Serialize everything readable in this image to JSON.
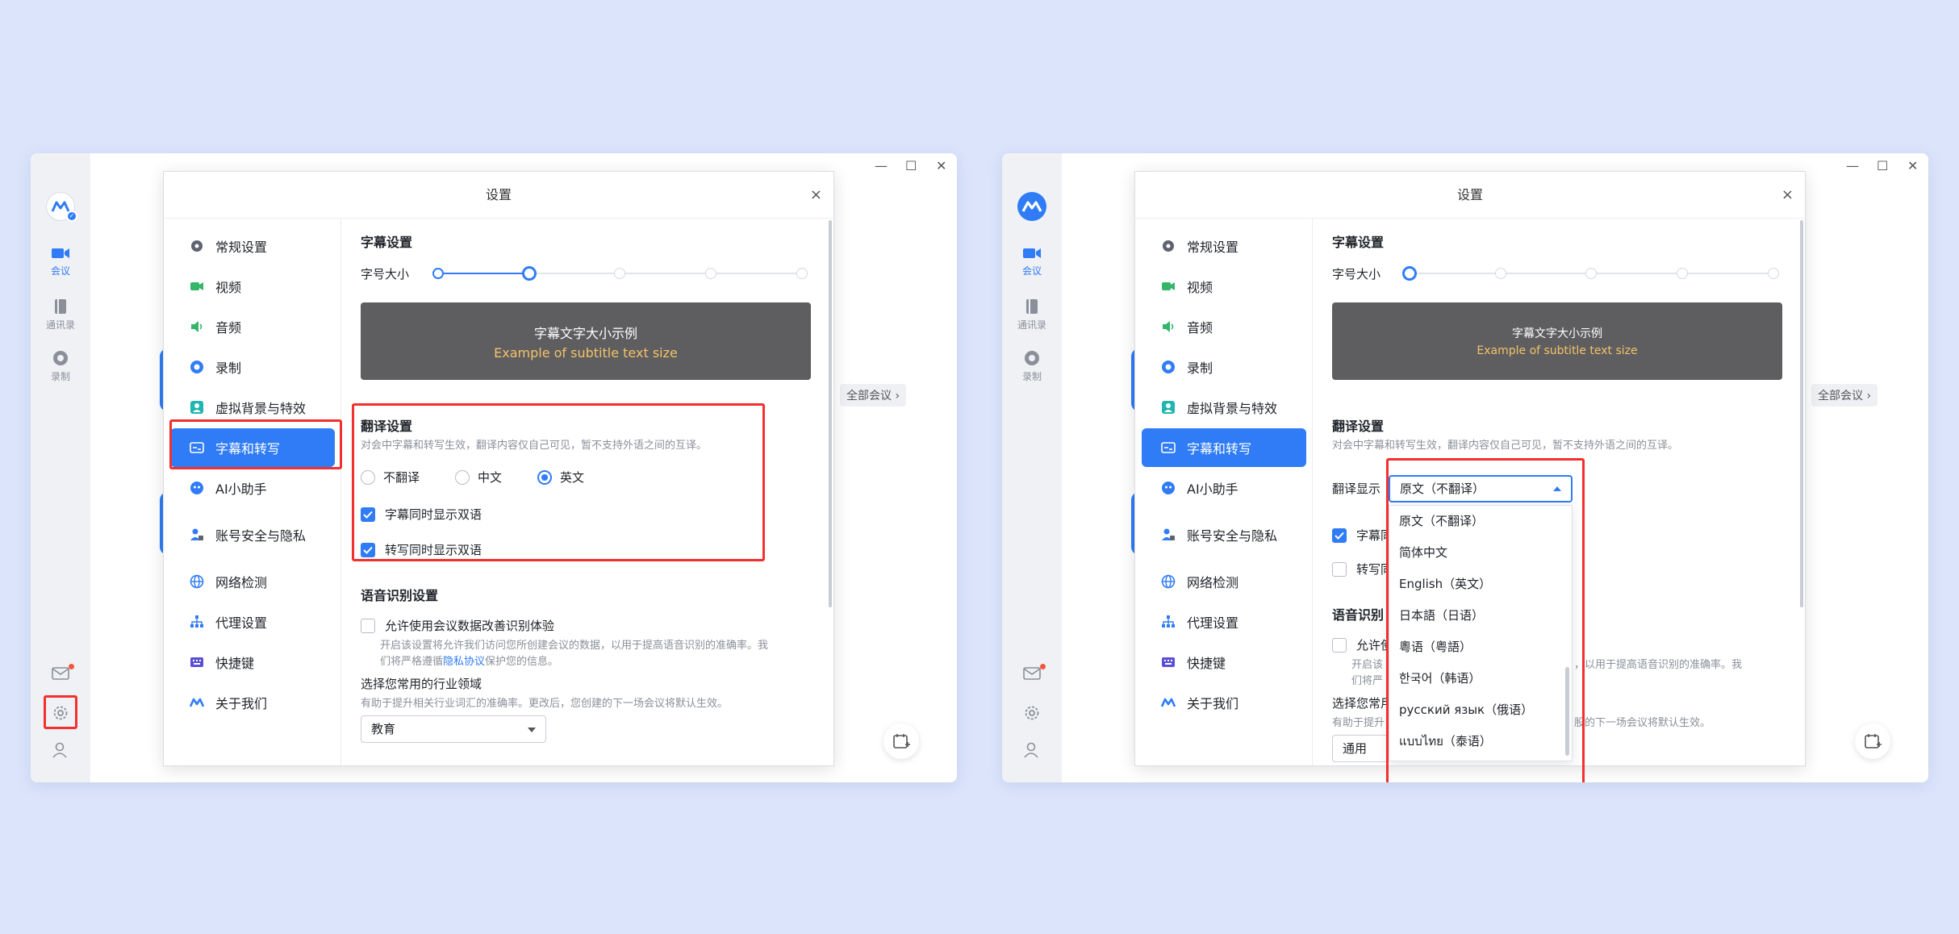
{
  "colors": {
    "accent": "#2f7cf6",
    "highlight": "#f2302f",
    "subtitle_en": "#f5c269",
    "background": "#dbe4fb"
  },
  "rail": {
    "items": [
      {
        "label": "会议",
        "icon": "video-camera-icon"
      },
      {
        "label": "通讯录",
        "icon": "address-book-icon"
      },
      {
        "label": "录制",
        "icon": "record-icon"
      }
    ],
    "bottom_icons": [
      "mail-icon",
      "gear-icon",
      "user-settings-icon"
    ]
  },
  "window": {
    "controls": [
      "—",
      "☐",
      "✕"
    ]
  },
  "all_meetings": "全部会议 ›",
  "dialog": {
    "title": "设置",
    "close": "×",
    "nav": [
      {
        "label": "常规设置",
        "icon": "gear-icon"
      },
      {
        "label": "视频",
        "icon": "video-icon"
      },
      {
        "label": "音频",
        "icon": "speaker-icon"
      },
      {
        "label": "录制",
        "icon": "record-icon"
      },
      {
        "label": "虚拟背景与特效",
        "icon": "portrait-icon"
      },
      {
        "label": "字幕和转写",
        "icon": "caption-icon"
      },
      {
        "label": "AI小助手",
        "icon": "ai-assistant-icon"
      },
      {
        "label": "账号安全与隐私",
        "icon": "account-security-icon"
      },
      {
        "label": "网络检测",
        "icon": "globe-icon"
      },
      {
        "label": "代理设置",
        "icon": "proxy-icon"
      },
      {
        "label": "快捷键",
        "icon": "keyboard-icon"
      },
      {
        "label": "关于我们",
        "icon": "logo-icon"
      }
    ]
  },
  "subtitle": {
    "section_title": "字幕设置",
    "size_label": "字号大小",
    "preview_cn": "字幕文字大小示例",
    "preview_en": "Example of subtitle text size"
  },
  "translation": {
    "section_title": "翻译设置",
    "note_left": "对会中字幕和转写生效，翻译内容仅自己可见，暂不支持外语之间的互译。",
    "note_right": "对会中字幕和转写生效，翻译内容仅自己可见，暂不支持外语之间的互译。",
    "options": [
      "不翻译",
      "中文",
      "英文"
    ],
    "selected_option": "英文",
    "bilingual_subtitle": "字幕同时显示双语",
    "bilingual_transcript": "转写同时显示双语",
    "display_label": "翻译显示",
    "display_value": "原文（不翻译）",
    "bilingual_subtitle_partial": "字幕同",
    "bilingual_transcript_partial": "转写同",
    "dropdown_options": [
      "原文（不翻译）",
      "简体中文",
      "English（英文）",
      "日本語（日语）",
      "粵语（粤語）",
      "한국어（韩语）",
      "русский язык（俄语）",
      "แบบไทย（泰语）"
    ]
  },
  "speech": {
    "section_title": "语音识别设置",
    "section_title_partial": "语音识别",
    "allow_label": "允许使用会议数据改善识别体验",
    "allow_partial": "允许使",
    "allow_desc_1": "开启该设置将允许我们访问您所创建会议的数据，以用于提高语音识别的准确率。我",
    "allow_desc_2_pre": "们将严格遵循",
    "allow_desc_link": "隐私协议",
    "allow_desc_2_post": "保护您的信息。",
    "right_desc_1a": "开启该",
    "right_desc_1b": "，以用于提高语音识别的准确率。我",
    "right_desc_2": "们将严",
    "industry_label": "选择您常用的行业领域",
    "industry_label_partial": "选择您常用",
    "industry_desc": "有助于提升相关行业词汇的准确率。更改后，您创建的下一场会议将默认生效。",
    "industry_desc_left_partial": "有助于提升",
    "industry_desc_right_partial": "股的下一场会议将默认生效。",
    "industry_value_left": "教育",
    "industry_value_right": "通用"
  }
}
